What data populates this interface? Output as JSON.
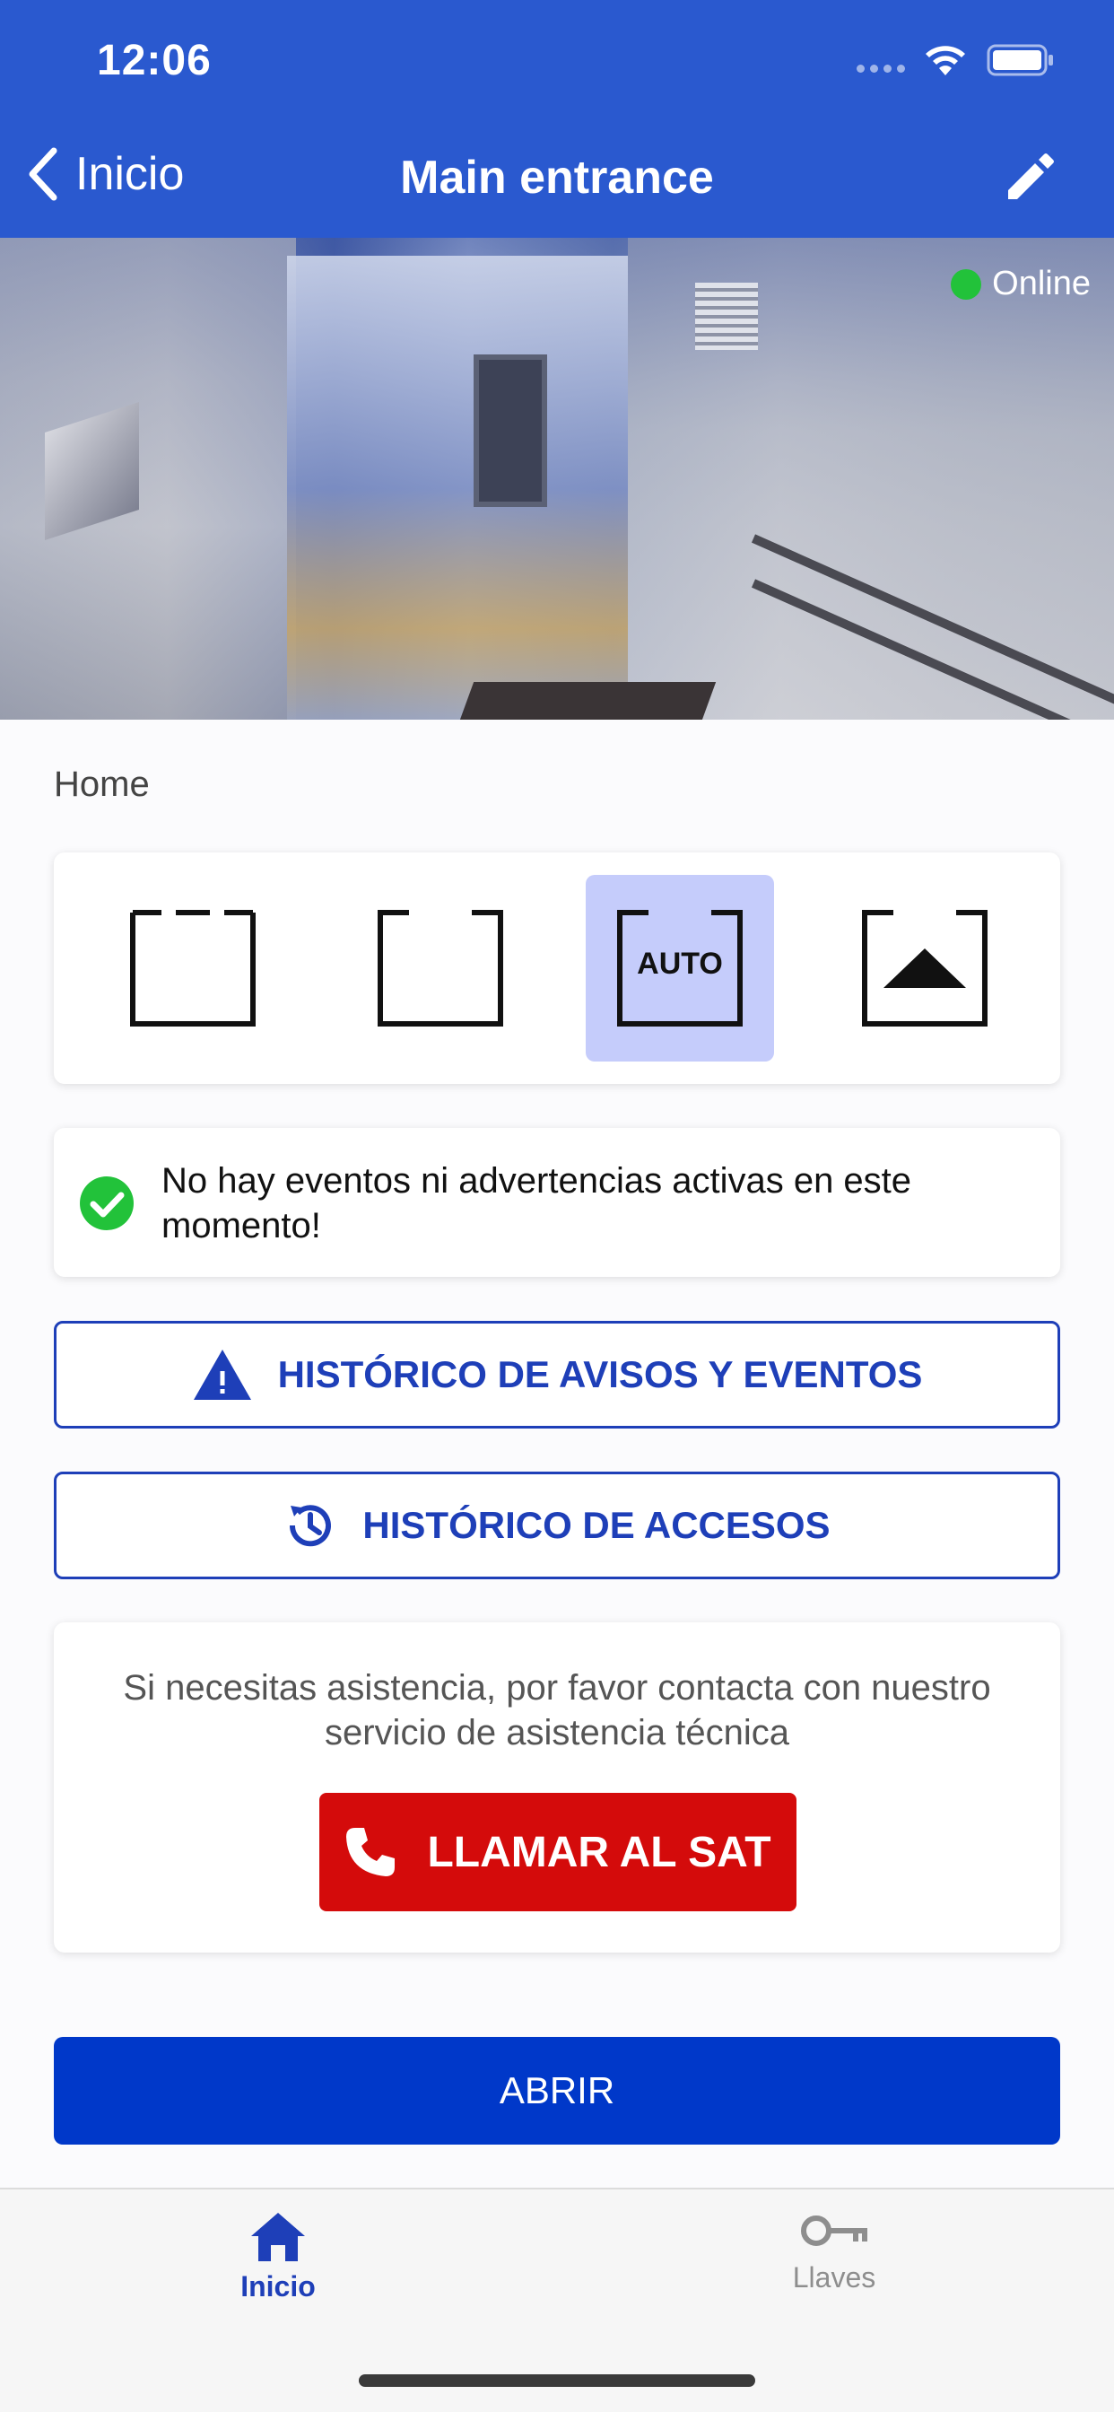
{
  "status_bar": {
    "time": "12:06"
  },
  "nav": {
    "back_label": "Inicio",
    "title": "Main entrance"
  },
  "hero": {
    "status_label": "Online",
    "status_color": "#22c23a"
  },
  "section": {
    "title": "Home"
  },
  "modes": {
    "items": [
      {
        "name": "closed",
        "label": "",
        "active": false
      },
      {
        "name": "open",
        "label": "",
        "active": false
      },
      {
        "name": "auto",
        "label": "AUTO",
        "active": true
      },
      {
        "name": "exit-only",
        "label": "",
        "active": false
      }
    ]
  },
  "info": {
    "message": "No hay eventos ni advertencias activas en este momento!"
  },
  "buttons": {
    "avisos_label": "HISTÓRICO DE AVISOS Y EVENTOS",
    "accesos_label": "HISTÓRICO DE ACCESOS",
    "abrir_label": "ABRIR"
  },
  "sat": {
    "text": "Si necesitas asistencia, por favor contacta con nuestro servicio de asistencia técnica",
    "button_label": "LLAMAR AL SAT"
  },
  "tabbar": {
    "items": [
      {
        "label": "Inicio",
        "icon": "home-icon",
        "active": true
      },
      {
        "label": "Llaves",
        "icon": "key-icon",
        "active": false
      }
    ]
  },
  "colors": {
    "header": "#2a59cf",
    "accent": "#1e3fb8",
    "primary_button": "#0038c9",
    "danger": "#d40b0b",
    "active_mode": "#c5ccfb",
    "success": "#22c23a"
  }
}
